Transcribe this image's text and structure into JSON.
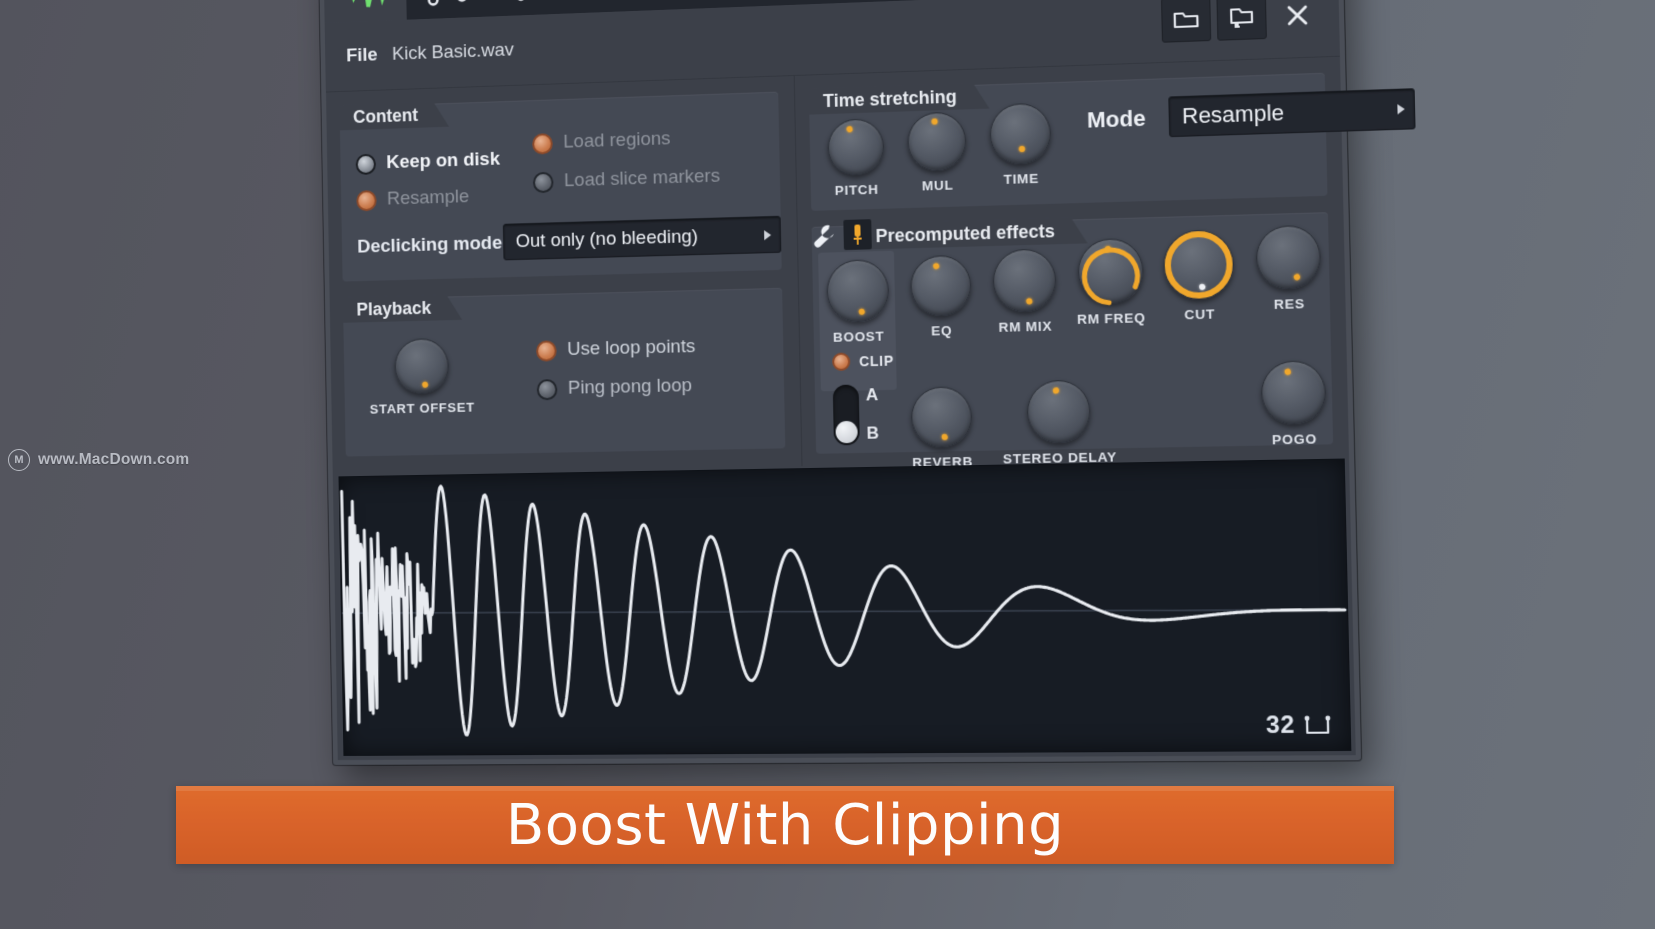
{
  "watermark": {
    "text": "www.MacDown.com",
    "logo_letter": "M",
    "icon": "macdown-logo-icon"
  },
  "banner": {
    "text": "Boost With Clipping",
    "bg_color": "#d9632a",
    "text_color": "#fdfdfd"
  },
  "window": {
    "tabs": [
      {
        "name": "sample-tab",
        "icon": "waveform-icon",
        "active": true,
        "color": "#6fe06f"
      },
      {
        "name": "envelope-tab",
        "icon": "envelope-curve-icon",
        "active": false,
        "color": "#ffffff"
      },
      {
        "name": "tools-tab",
        "icon": "wrench-icon",
        "active": false,
        "color": "#ffffff"
      }
    ],
    "filebar": {
      "label": "File",
      "filename": "Kick Basic.wav",
      "buttons": [
        {
          "name": "open-file-button",
          "icon": "folder-icon"
        },
        {
          "name": "save-file-button",
          "icon": "folder-save-icon"
        },
        {
          "name": "close-file-button",
          "icon": "close-x-icon"
        }
      ]
    },
    "content": {
      "title": "Content",
      "options": [
        {
          "label": "Keep on disk",
          "selected": true,
          "style": "bold"
        },
        {
          "label": "Resample",
          "selected": true,
          "style": "dim"
        },
        {
          "label": "Load regions",
          "selected": true,
          "style": "dim"
        },
        {
          "label": "Load slice markers",
          "selected": false,
          "style": "dim"
        }
      ],
      "declicking": {
        "label": "Declicking mode",
        "value": "Out only (no bleeding)"
      }
    },
    "playback": {
      "title": "Playback",
      "knob": {
        "label": "START OFFSET",
        "value_deg": 0
      },
      "options": [
        {
          "label": "Use loop points",
          "selected": true
        },
        {
          "label": "Ping pong loop",
          "selected": false
        }
      ]
    },
    "time_stretching": {
      "title": "Time stretching",
      "knobs": [
        {
          "label": "PITCH",
          "value_deg": -18
        },
        {
          "label": "MUL",
          "value_deg": -5
        },
        {
          "label": "TIME",
          "value_deg": 175
        }
      ],
      "mode": {
        "label": "Mode",
        "value": "Resample"
      }
    },
    "precomputed_effects": {
      "title": "Precomputed effects",
      "icons": [
        {
          "name": "wrench-icon"
        },
        {
          "name": "plugin-pin-icon",
          "active": true,
          "color": "#f0a72c"
        }
      ],
      "row1": [
        {
          "label": "BOOST",
          "value_deg": 170,
          "ring": "none",
          "highlight": true,
          "dot": "orange"
        },
        {
          "label": "EQ",
          "value_deg": -12,
          "ring": "none",
          "highlight": false,
          "dot": "orange"
        },
        {
          "label": "RM MIX",
          "value_deg": 168,
          "ring": "none",
          "highlight": false,
          "dot": "orange"
        },
        {
          "label": "RM FREQ",
          "value_deg": -6,
          "ring": "arc",
          "highlight": false,
          "dot": "orange"
        },
        {
          "label": "CUT",
          "value_deg": 172,
          "ring": "full",
          "highlight": false,
          "dot": "white"
        },
        {
          "label": "RES",
          "value_deg": 158,
          "ring": "none",
          "highlight": false,
          "dot": "orange"
        }
      ],
      "clip": {
        "label": "CLIP",
        "selected": true
      },
      "ab_switch": {
        "a_label": "A",
        "b_label": "B",
        "position": "B"
      },
      "row2": [
        {
          "label": "REVERB",
          "value_deg": 172
        },
        {
          "label": "STEREO DELAY",
          "value_deg": -6
        },
        {
          "label": "POGO",
          "value_deg": -14
        }
      ]
    },
    "waveform": {
      "zoom_count": "32",
      "zoom_icon": "selection-marker-icon",
      "stroke_color": "#e8ebf0",
      "bg_color": "#171c24"
    }
  }
}
